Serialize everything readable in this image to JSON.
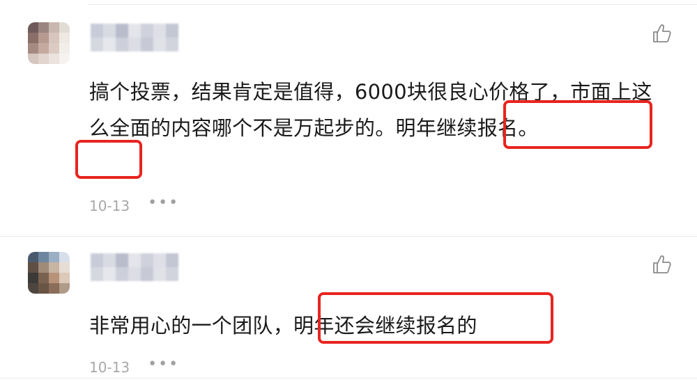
{
  "comments": [
    {
      "avatar_colors": [
        "#6e5a5a",
        "#9a8580",
        "#c9b8b0",
        "#e2dcd6",
        "#8a6e68",
        "#b79a90",
        "#d8c6be",
        "#efe9e4",
        "#a58a82",
        "#c5aaa0",
        "#dccbc3",
        "#f2eeea",
        "#d6c6c0",
        "#e2d4ce",
        "#ece3de",
        "#f6f2ef"
      ],
      "username_colors": [
        "#c8ccd8",
        "#d9dbe3",
        "#b9bccb",
        "#e4e5ea",
        "#cfd1dc",
        "#dfe0e7",
        "#c3c6d3",
        "#d6d8e0",
        "#e6e7ec",
        "#cdd0da",
        "#dcdde5",
        "#c7cad6",
        "#e1e2e8",
        "#d2d4dd"
      ],
      "text_part1": "搞个投票，结果肯定是值得，6000块很良心价格了，市面上这么全面的内容哪个不是万起步的。",
      "text_highlight": "明年继续报名。",
      "date": "10-13",
      "more": "•••",
      "like_icon": "thumbs-up-outline"
    },
    {
      "avatar_colors": [
        "#4a5a6e",
        "#6f86a0",
        "#9aafc4",
        "#d7e0ea",
        "#5e4e44",
        "#a08a78",
        "#c8b4a2",
        "#e6ddd4",
        "#3c3a38",
        "#7a6250",
        "#b8937a",
        "#dcc9b8",
        "#4e463e",
        "#6a5444",
        "#8a6e5a",
        "#b09a88"
      ],
      "username_colors": [
        "#c8ccd8",
        "#d9dbe3",
        "#b9bccb",
        "#e4e5ea",
        "#cfd1dc",
        "#dfe0e7",
        "#c3c6d3",
        "#d6d8e0",
        "#e6e7ec",
        "#cdd0da",
        "#dcdde5",
        "#c7cad6",
        "#e1e2e8",
        "#d2d4dd"
      ],
      "text_part1": "非常用心的一个团队，",
      "text_highlight": "明年还会继续报名的",
      "date": "10-13",
      "more": "•••",
      "like_icon": "thumbs-up-outline"
    }
  ],
  "colors": {
    "highlight_box": "#e8241f",
    "meta_text": "#a8a8a8"
  }
}
